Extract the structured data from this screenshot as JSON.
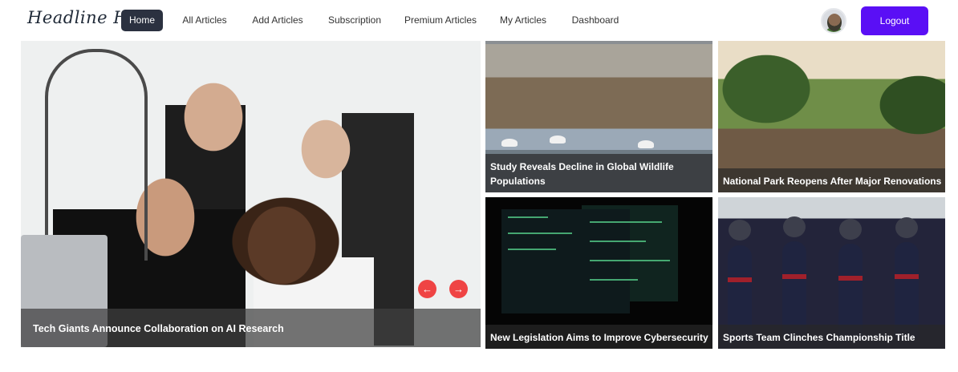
{
  "brand": {
    "name": "Headline Hub"
  },
  "nav": {
    "items": [
      {
        "label": "Home",
        "active": true
      },
      {
        "label": "All Articles",
        "active": false
      },
      {
        "label": "Add Articles",
        "active": false
      },
      {
        "label": "Subscription",
        "active": false
      },
      {
        "label": "Premium Articles",
        "active": false
      },
      {
        "label": "My Articles",
        "active": false
      },
      {
        "label": "Dashboard",
        "active": false
      }
    ],
    "logout_label": "Logout"
  },
  "hero": {
    "caption": "Tech Giants Announce Collaboration on AI Research",
    "prev_icon": "arrow-left-icon",
    "next_icon": "arrow-right-icon"
  },
  "cards": [
    {
      "title": "Study Reveals Decline in Global Wildlife Populations"
    },
    {
      "title": "National Park Reopens After Major Renovations"
    },
    {
      "title": "New Legislation Aims to Improve Cybersecurity"
    },
    {
      "title": "Sports Team Clinches Championship Title"
    }
  ],
  "colors": {
    "accent": "#5a0ff5",
    "nav_active": "#2b3140",
    "slider_arrows": "#ef4444"
  }
}
